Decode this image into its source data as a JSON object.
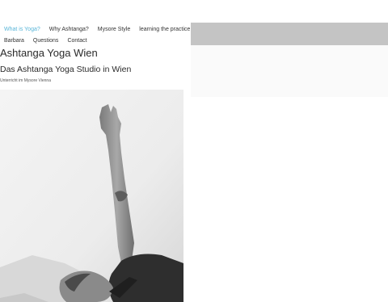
{
  "nav": {
    "items": [
      {
        "label": "What is Yoga?",
        "active": true
      },
      {
        "label": "Why Ashtanga?",
        "active": false
      },
      {
        "label": "Mysore Style",
        "active": false
      },
      {
        "label": "learning the practice",
        "active": false
      },
      {
        "label": "Barbara",
        "active": false
      },
      {
        "label": "Questions",
        "active": false
      },
      {
        "label": "Contact",
        "active": false
      }
    ]
  },
  "site": {
    "title": "Ashtanga Yoga Wien",
    "subtitle": "Das Ashtanga Yoga Studio in Wien",
    "tagline": "Unterricht im Mysore Vienna"
  },
  "hero": {
    "icon": "yoga-photo",
    "colors": {
      "accent": "#58b5d8",
      "navbar": "#c4c4c4"
    }
  }
}
